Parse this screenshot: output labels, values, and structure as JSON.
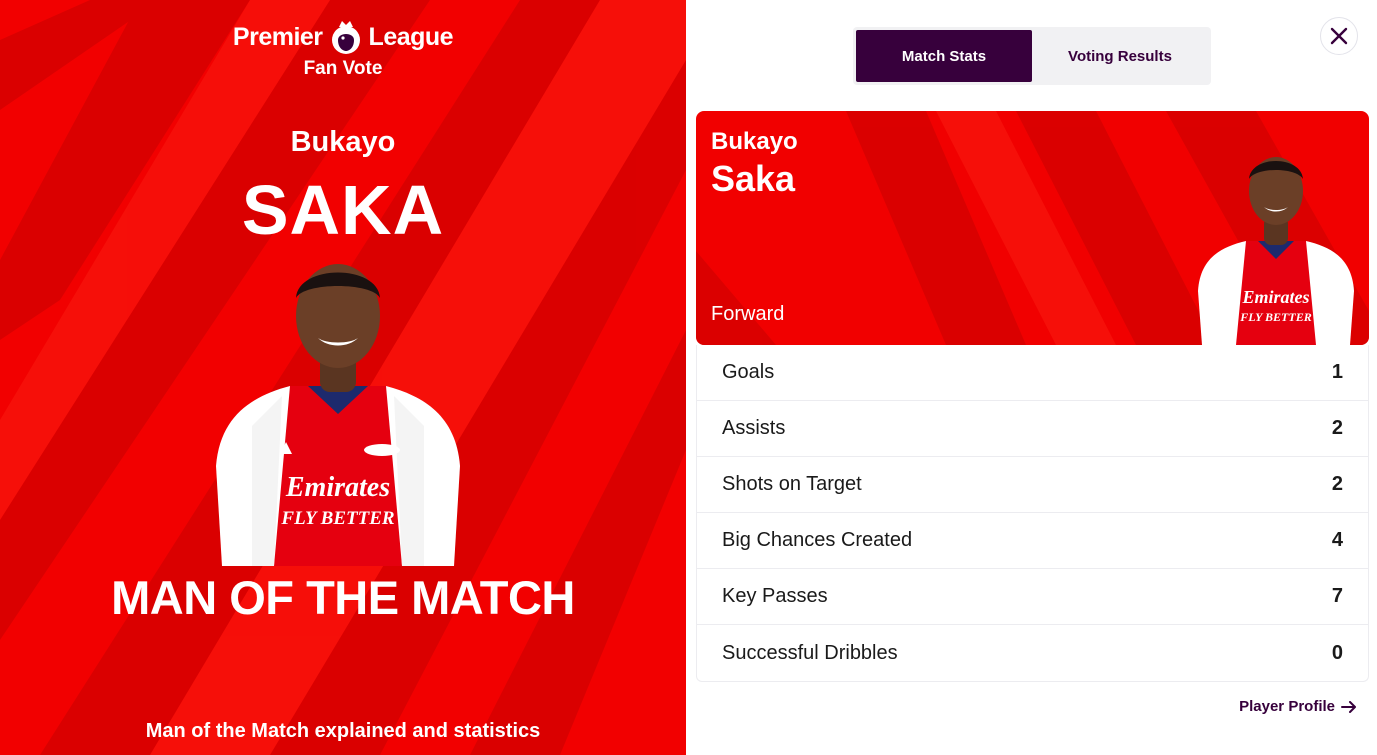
{
  "left": {
    "logo": {
      "word1": "Premier",
      "word2": "League",
      "subtitle": "Fan Vote"
    },
    "player": {
      "first_name": "Bukayo",
      "last_name": "SAKA"
    },
    "award": "MAN OF THE MATCH",
    "explained_link": "Man of the Match explained and statistics",
    "shirt": {
      "sponsor": "Emirates",
      "slogan": "FLY BETTER"
    }
  },
  "right": {
    "tabs": [
      {
        "label": "Match Stats",
        "active": true
      },
      {
        "label": "Voting Results",
        "active": false
      }
    ],
    "card": {
      "first_name": "Bukayo",
      "last_name": "Saka",
      "position": "Forward"
    },
    "stats": [
      {
        "label": "Goals",
        "value": "1"
      },
      {
        "label": "Assists",
        "value": "2"
      },
      {
        "label": "Shots on Target",
        "value": "2"
      },
      {
        "label": "Big Chances Created",
        "value": "4"
      },
      {
        "label": "Key Passes",
        "value": "7"
      },
      {
        "label": "Successful Dribbles",
        "value": "0"
      }
    ],
    "profile_link": "Player Profile"
  },
  "colors": {
    "arsenal_red": "#f20000",
    "pl_purple": "#37003c",
    "tab_bg": "#f1f1f3",
    "white": "#ffffff"
  },
  "icons": {
    "close": "close-icon",
    "arrow": "arrow-right-icon",
    "lion": "premier-league-lion-icon"
  }
}
